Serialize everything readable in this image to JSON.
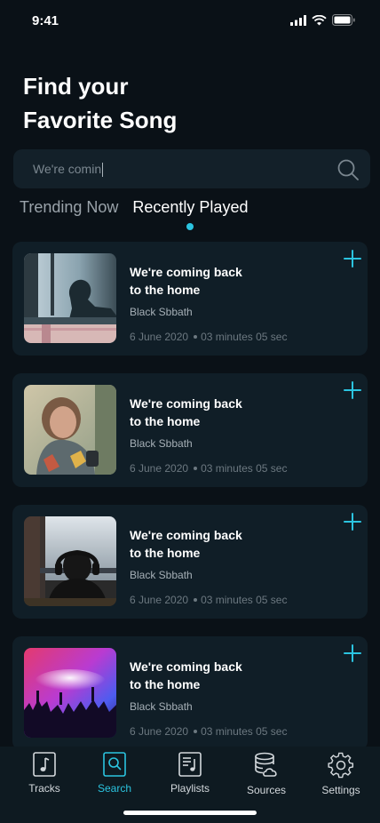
{
  "status": {
    "time": "9:41"
  },
  "header": {
    "title_line1": "Find your",
    "title_line2": "Favorite Song"
  },
  "search": {
    "value": "We're comin"
  },
  "tabs": [
    {
      "label": "Trending Now",
      "active": false
    },
    {
      "label": "Recently Played",
      "active": true
    }
  ],
  "songs": [
    {
      "title_line1": "We're coming back",
      "title_line2": "to the home",
      "artist": "Black Sbbath",
      "date": "6 June 2020",
      "duration": "03 minutes 05 sec",
      "thumb": "man-silhouette-window-icon"
    },
    {
      "title_line1": "We're coming back",
      "title_line2": "to the home",
      "artist": "Black Sbbath",
      "date": "6 June 2020",
      "duration": "03 minutes 05 sec",
      "thumb": "woman-headphones-photo"
    },
    {
      "title_line1": "We're coming back",
      "title_line2": "to the home",
      "artist": "Black Sbbath",
      "date": "6 June 2020",
      "duration": "03 minutes 05 sec",
      "thumb": "headphones-silhouette-window-photo"
    },
    {
      "title_line1": "We're coming back",
      "title_line2": "to the home",
      "artist": "Black Sbbath",
      "date": "6 June 2020",
      "duration": "03 minutes 05 sec",
      "thumb": "concert-crowd-photo"
    }
  ],
  "nav": [
    {
      "label": "Tracks",
      "icon": "music-note-icon",
      "active": false
    },
    {
      "label": "Search",
      "icon": "search-icon",
      "active": true
    },
    {
      "label": "Playlists",
      "icon": "playlist-icon",
      "active": false
    },
    {
      "label": "Sources",
      "icon": "database-cloud-icon",
      "active": false
    },
    {
      "label": "Settings",
      "icon": "gear-icon",
      "active": false
    }
  ],
  "colors": {
    "accent": "#2bc4e0",
    "background": "#0a1117",
    "card": "#101e27"
  }
}
